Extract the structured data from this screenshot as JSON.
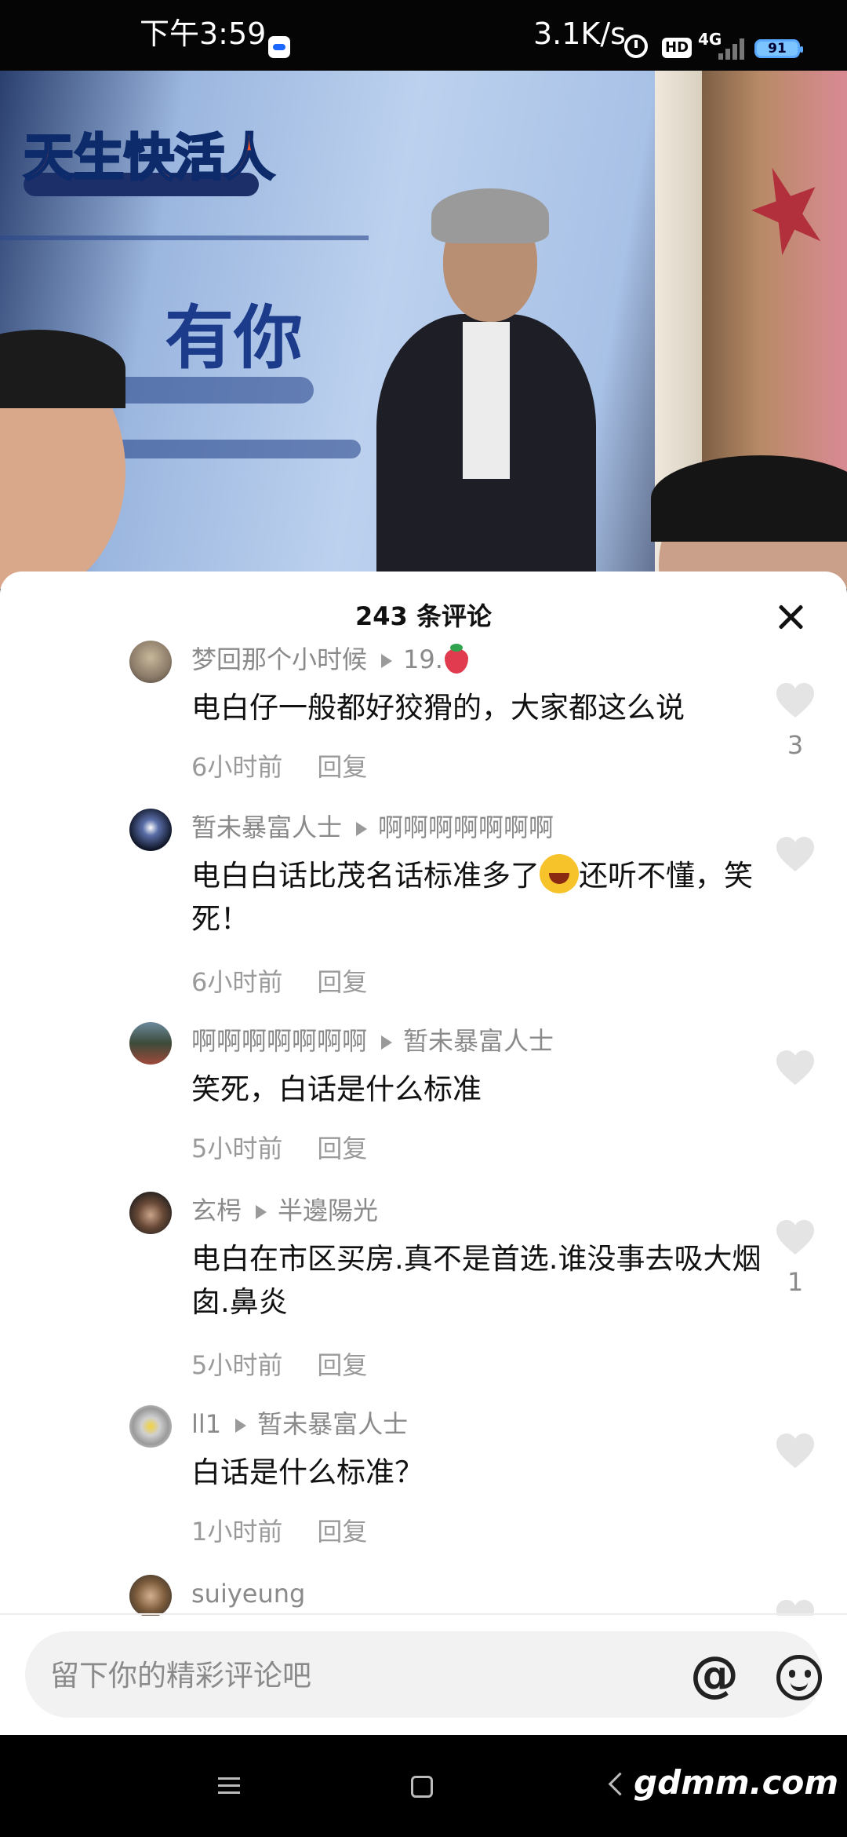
{
  "status_bar": {
    "time": "下午3:59",
    "network_speed": "3.1K/s",
    "hd_label": "HD",
    "network_type": "4G",
    "battery": "91"
  },
  "video": {
    "logo_text": "天生快活人",
    "banner_text": "有你"
  },
  "comments_panel": {
    "title": "243 条评论",
    "close_icon": "close-icon",
    "comments": [
      {
        "user": "梦回那个小时候",
        "reply_to": "19.",
        "text": "电白仔一般都好狡猾的，大家都这么说",
        "time": "6小时前",
        "reply": "回复",
        "likes": "3"
      },
      {
        "user": "暂未暴富人士",
        "reply_to": "啊啊啊啊啊啊啊",
        "text_before": "电白白话比茂名话标准多了",
        "text_after": "还听不懂，笑死！",
        "time": "6小时前",
        "reply": "回复",
        "likes": ""
      },
      {
        "user": "啊啊啊啊啊啊啊",
        "reply_to": "暂未暴富人士",
        "text": "笑死，白话是什么标准",
        "time": "5小时前",
        "reply": "回复",
        "likes": ""
      },
      {
        "user": "玄枵",
        "reply_to": "半邊陽光",
        "text": "电白在市区买房.真不是首选.谁没事去吸大烟囱.鼻炎",
        "time": "5小时前",
        "reply": "回复",
        "likes": "1"
      },
      {
        "user": "ll1",
        "reply_to": "暂未暴富人士",
        "text": "白话是什么标准？",
        "time": "1小时前",
        "reply": "回复",
        "likes": ""
      },
      {
        "user": "suiyeung"
      }
    ]
  },
  "input_bar": {
    "placeholder": "留下你的精彩评论吧",
    "at_symbol": "@"
  },
  "nav_bar": {
    "watermark": "gdmm.com"
  }
}
